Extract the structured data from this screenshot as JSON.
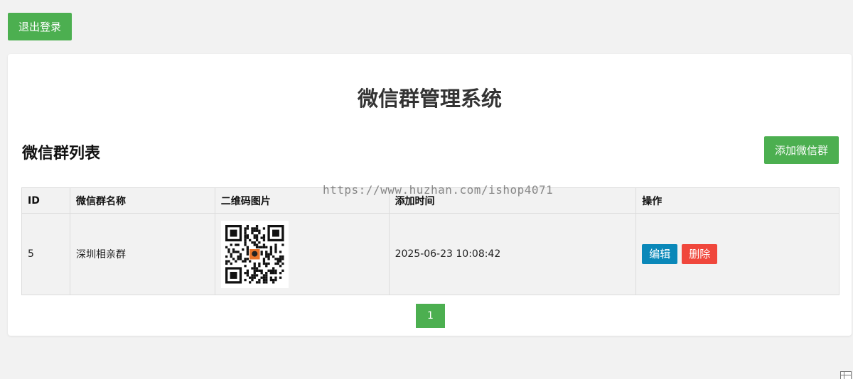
{
  "header": {
    "logout_label": "退出登录"
  },
  "main": {
    "title": "微信群管理系统",
    "section_title": "微信群列表",
    "add_button_label": "添加微信群"
  },
  "table": {
    "headers": [
      "ID",
      "微信群名称",
      "二维码图片",
      "添加时间",
      "操作"
    ],
    "rows": [
      {
        "id": "5",
        "name": "深圳相亲群",
        "qr_icon": "qr-code",
        "time": "2025-06-23 10:08:42",
        "edit_label": "编辑",
        "delete_label": "删除"
      }
    ]
  },
  "pagination": {
    "current": "1"
  },
  "watermark": "https://www.huzhan.com/ishop4071",
  "colors": {
    "primary_green": "#4caf50",
    "edit_blue": "#0a88b9",
    "delete_red": "#f0473c",
    "background": "#f2f2f2"
  }
}
